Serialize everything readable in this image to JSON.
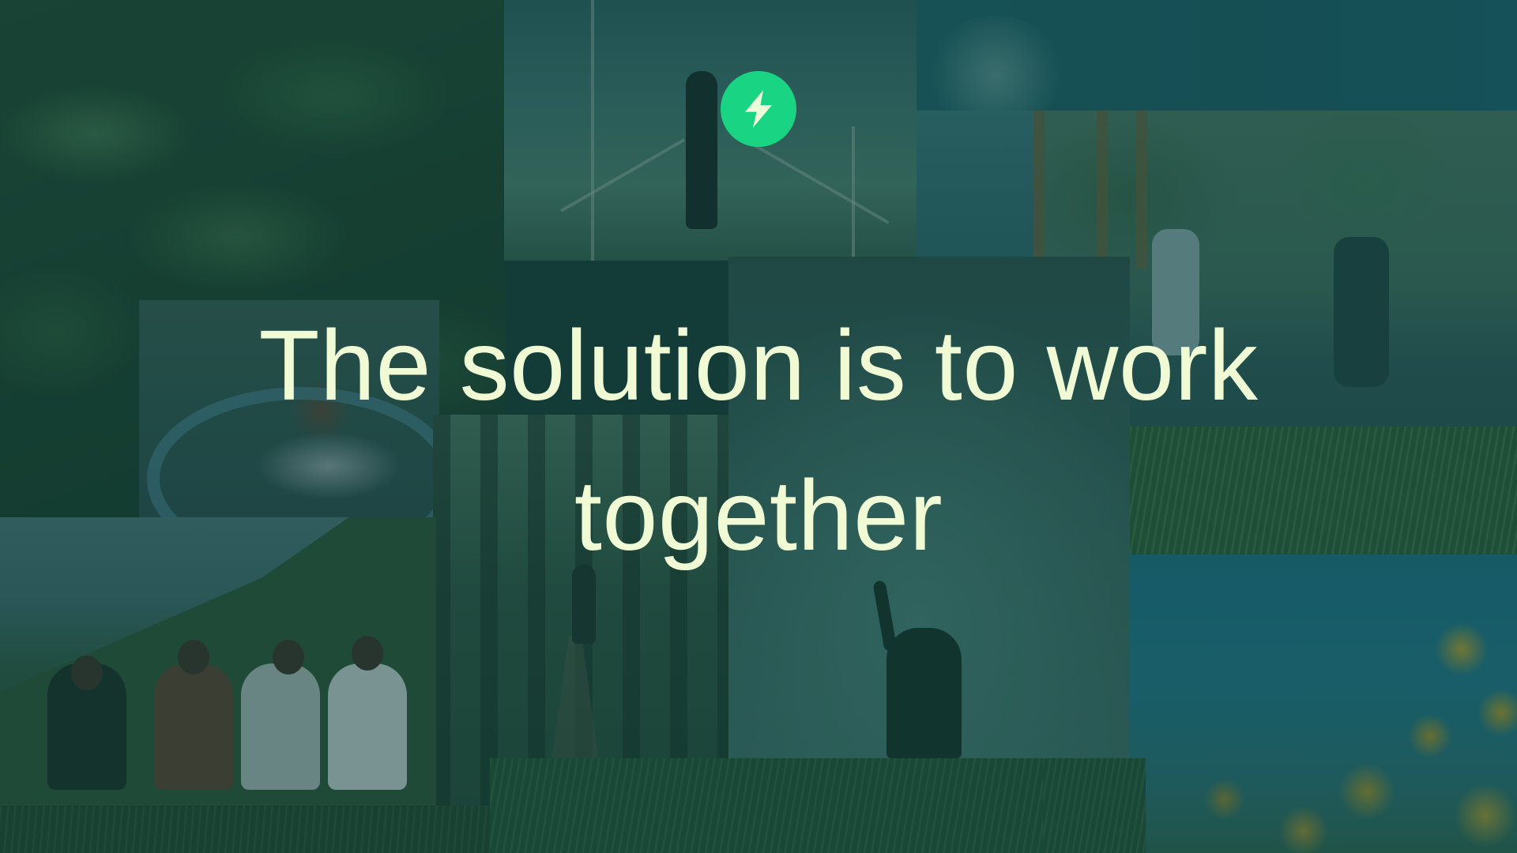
{
  "slide": {
    "headline": "The solution is to work together",
    "logo_icon": "lightning-bolt-icon",
    "colors": {
      "logo_circle": "#19d483",
      "logo_bolt": "#eaffd9",
      "headline_text": "#f0fad5",
      "overlay_tint": "#0e4440"
    }
  }
}
